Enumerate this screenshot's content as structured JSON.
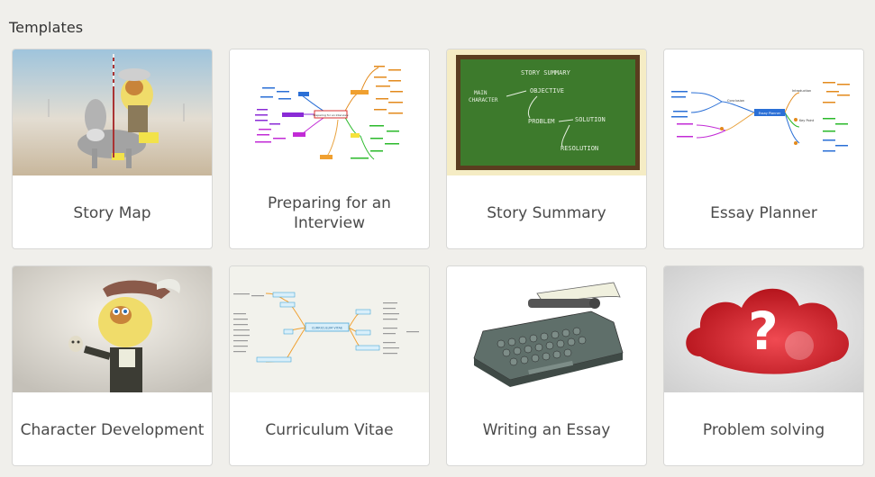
{
  "section": {
    "title": "Templates"
  },
  "templates": [
    {
      "label": "Story Map",
      "thumbnail": "cartoon-dog-knight-on-donkey"
    },
    {
      "label": "Preparing for an Interview",
      "thumbnail": "mind-map"
    },
    {
      "label": "Story Summary",
      "thumbnail": "chalkboard"
    },
    {
      "label": "Essay Planner",
      "thumbnail": "mind-map"
    },
    {
      "label": "Character Development",
      "thumbnail": "cartoon-dog-holding-skull"
    },
    {
      "label": "Curriculum Vitae",
      "thumbnail": "mind-map"
    },
    {
      "label": "Writing an Essay",
      "thumbnail": "typewriter"
    },
    {
      "label": "Problem solving",
      "thumbnail": "red-cloud-question-mark"
    }
  ],
  "chalkboard": {
    "title": "STORY SUMMARY",
    "main_character": "MAIN\nCHARACTER",
    "objective": "OBJECTIVE",
    "problem": "PROBLEM",
    "solution": "SOLUTION",
    "resolution": "RESOLUTION"
  },
  "mindmaps": {
    "interview_center": "Preparing for an Interview",
    "essay_center": "Essay Planner",
    "essay_intro": "Introduction",
    "essay_conclusion": "Conclusion",
    "essay_key_point": "Key Point",
    "cv_center": "CURRICULUM VITAE"
  },
  "colors": {
    "page_bg": "#f0efeb",
    "card_border": "#d8d8d6",
    "label_text": "#4a4a4a",
    "chalkboard_green": "#3d7a2c",
    "cloud_red": "#d6202b"
  }
}
